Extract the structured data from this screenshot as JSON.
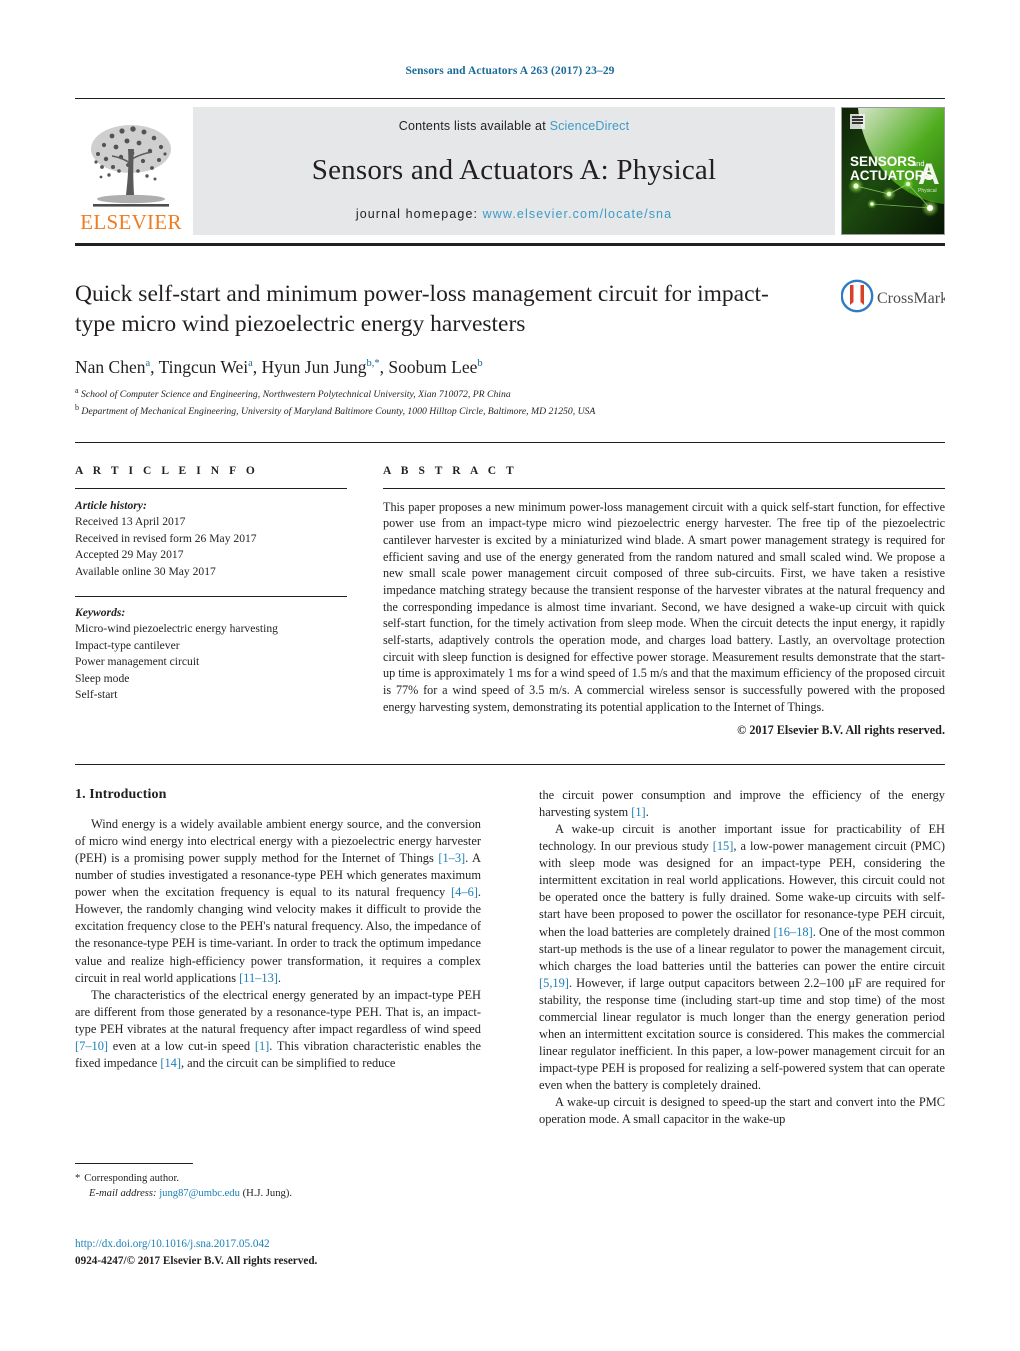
{
  "running_head": "Sensors and Actuators A 263 (2017) 23–29",
  "masthead": {
    "publisher_name": "ELSEVIER",
    "contents_prefix": "Contents lists available at",
    "contents_link": "ScienceDirect",
    "journal_title": "Sensors and Actuators A: Physical",
    "homepage_prefix": "journal homepage:",
    "homepage_link": "www.elsevier.com/locate/sna",
    "cover": {
      "line1": "SENSORS",
      "line1_suffix": "and",
      "line2": "ACTUATORS",
      "big_letter": "A",
      "sub_label": "Physical"
    }
  },
  "article": {
    "title": "Quick self-start and minimum power-loss management circuit for impact-type micro wind piezoelectric energy harvesters",
    "authors": [
      {
        "name": "Nan Chen",
        "sup": "a",
        "sep": ", "
      },
      {
        "name": "Tingcun Wei",
        "sup": "a",
        "sep": ", "
      },
      {
        "name": "Hyun Jun Jung",
        "sup": "b,*",
        "sep": ", "
      },
      {
        "name": "Soobum Lee",
        "sup": "b",
        "sep": ""
      }
    ],
    "affiliations": [
      {
        "marker": "a",
        "text": "School of Computer Science and Engineering, Northwestern Polytechnical University, Xian 710072, PR China"
      },
      {
        "marker": "b",
        "text": "Department of Mechanical Engineering, University of Maryland Baltimore County, 1000 Hilltop Circle, Baltimore, MD 21250, USA"
      }
    ],
    "crossmark_label": "CrossMark"
  },
  "article_info": {
    "heading": "A R T I C L E     I N F O",
    "history_label": "Article history:",
    "history": [
      "Received 13 April 2017",
      "Received in revised form 26 May 2017",
      "Accepted 29 May 2017",
      "Available online 30 May 2017"
    ],
    "keywords_label": "Keywords:",
    "keywords": [
      "Micro-wind piezoelectric energy harvesting",
      "Impact-type cantilever",
      "Power management circuit",
      "Sleep mode",
      "Self-start"
    ]
  },
  "abstract": {
    "heading": "A B S T R A C T",
    "text": "This paper proposes a new minimum power-loss management circuit with a quick self-start function, for effective power use from an impact-type micro wind piezoelectric energy harvester. The free tip of the piezoelectric cantilever harvester is excited by a miniaturized wind blade. A smart power management strategy is required for efficient saving and use of the energy generated from the random natured and small scaled wind. We propose a new small scale power management circuit composed of three sub-circuits. First, we have taken a resistive impedance matching strategy because the transient response of the harvester vibrates at the natural frequency and the corresponding impedance is almost time invariant. Second, we have designed a wake-up circuit with quick self-start function, for the timely activation from sleep mode. When the circuit detects the input energy, it rapidly self-starts, adaptively controls the operation mode, and charges load battery. Lastly, an overvoltage protection circuit with sleep function is designed for effective power storage. Measurement results demonstrate that the start-up time is approximately 1 ms for a wind speed of 1.5 m/s and that the maximum efficiency of the proposed circuit is 77% for a wind speed of 3.5 m/s. A commercial wireless sensor is successfully powered with the proposed energy harvesting system, demonstrating its potential application to the Internet of Things.",
    "copyright": "© 2017 Elsevier B.V. All rights reserved."
  },
  "body": {
    "section_number_title": "1.  Introduction",
    "left_column": [
      {
        "id": "p1",
        "segments": [
          {
            "t": "Wind energy is a widely available ambient energy source, and the conversion of micro wind energy into electrical energy with a piezoelectric energy harvester (PEH) is a promising power supply method for the Internet of Things "
          },
          {
            "t": "[1–3]",
            "cite": true
          },
          {
            "t": ". A number of studies investigated a resonance-type PEH which generates maximum power when the excitation frequency is equal to its natural frequency "
          },
          {
            "t": "[4–6]",
            "cite": true
          },
          {
            "t": ". However, the randomly changing wind velocity makes it difficult to provide the excitation frequency close to the PEH's natural frequency. Also, the impedance of the resonance-type PEH is time-variant. In order to track the optimum impedance value and realize high-efficiency power transformation, it requires a complex circuit in real world applications "
          },
          {
            "t": "[11–13]",
            "cite": true
          },
          {
            "t": "."
          }
        ]
      },
      {
        "id": "p2",
        "segments": [
          {
            "t": "The characteristics of the electrical energy generated by an impact-type PEH are different from those generated by a resonance-type PEH. That is, an impact-type PEH vibrates at the natural frequency after impact regardless of wind speed "
          },
          {
            "t": "[7–10]",
            "cite": true
          },
          {
            "t": " even at a low cut-in speed "
          },
          {
            "t": "[1]",
            "cite": true
          },
          {
            "t": ". This vibration characteristic enables the fixed impedance "
          },
          {
            "t": "[14]",
            "cite": true
          },
          {
            "t": ", and the circuit can be simplified to reduce"
          }
        ]
      }
    ],
    "right_column": [
      {
        "id": "p3",
        "segments": [
          {
            "t": "the circuit power consumption and improve the efficiency of the energy harvesting system "
          },
          {
            "t": "[1]",
            "cite": true
          },
          {
            "t": "."
          }
        ]
      },
      {
        "id": "p4",
        "segments": [
          {
            "t": "A wake-up circuit is another important issue for practicability of EH technology. In our previous study "
          },
          {
            "t": "[15]",
            "cite": true
          },
          {
            "t": ", a low-power management circuit (PMC) with sleep mode was designed for an impact-type PEH, considering the intermittent excitation in real world applications. However, this circuit could not be operated once the battery is fully drained. Some wake-up circuits with self-start have been proposed to power the oscillator for resonance-type PEH circuit, when the load batteries are completely drained "
          },
          {
            "t": "[16–18]",
            "cite": true
          },
          {
            "t": ". One of the most common start-up methods is the use of a linear regulator to power the management circuit, which charges the load batteries until the batteries can power the entire circuit "
          },
          {
            "t": "[5,19]",
            "cite": true
          },
          {
            "t": ". However, if large output capacitors between 2.2–100 μF are required for stability, the response time (including start-up time and stop time) of the most commercial linear regulator is much longer than the energy generation period when an intermittent excitation source is considered. This makes the commercial linear regulator inefficient. In this paper, a low-power management circuit for an impact-type PEH is proposed for realizing a self-powered system that can operate even when the battery is completely drained."
          }
        ]
      },
      {
        "id": "p5",
        "segments": [
          {
            "t": "A wake-up circuit is designed to speed-up the start and convert into the PMC operation mode. A small capacitor in the wake-up"
          }
        ]
      }
    ]
  },
  "footnotes": {
    "corresponding_marker": "*",
    "corresponding_text": "Corresponding author.",
    "email_label": "E-mail address:",
    "email": "jung87@umbc.edu",
    "email_owner": "(H.J. Jung).",
    "doi": "http://dx.doi.org/10.1016/j.sna.2017.05.042",
    "issn_line": "0924-4247/© 2017 Elsevier B.V. All rights reserved."
  },
  "colors": {
    "link_blue": "#1a7fb5",
    "header_blue": "#1a6b9a",
    "elsevier_orange": "#f07c22",
    "masthead_gray": "#e6e7e8"
  }
}
